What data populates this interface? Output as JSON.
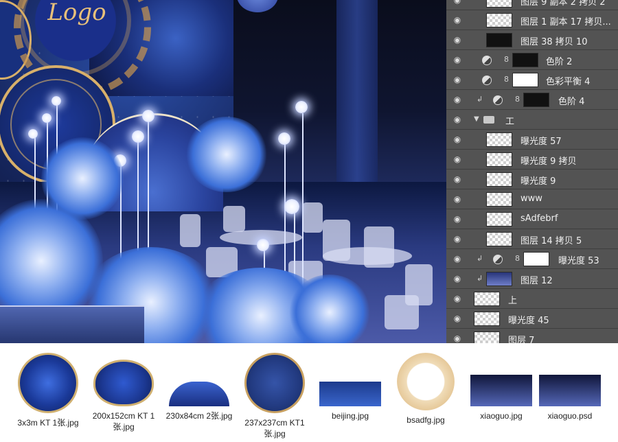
{
  "canvas": {
    "logo_text": "Logo"
  },
  "layers": [
    {
      "name": "图层 9 副本 2 拷贝 2",
      "kind": "pixel"
    },
    {
      "name": "图层 1 副本 17 拷贝...",
      "kind": "pixel"
    },
    {
      "name": "图层 38 拷贝 10",
      "kind": "dark"
    },
    {
      "name": "色阶 2",
      "kind": "adjustment"
    },
    {
      "name": "色彩平衡 4",
      "kind": "adjustment"
    },
    {
      "name": "色阶 4",
      "kind": "adjustment-clipped"
    },
    {
      "name": "工",
      "kind": "group"
    },
    {
      "name": "曝光度 57",
      "kind": "pixel"
    },
    {
      "name": "曝光度 9 拷贝",
      "kind": "pixel"
    },
    {
      "name": "曝光度 9",
      "kind": "pixel"
    },
    {
      "name": "www",
      "kind": "pixel"
    },
    {
      "name": "sAdfebrf",
      "kind": "pixel"
    },
    {
      "name": "图层 14 拷贝 5",
      "kind": "pixel"
    },
    {
      "name": "曝光度 53",
      "kind": "adjustment-clipped"
    },
    {
      "name": "图层 12",
      "kind": "pixel-clipped"
    },
    {
      "name": "上",
      "kind": "pixel-top"
    },
    {
      "name": "曝光度 45",
      "kind": "pixel-top"
    },
    {
      "name": "图层 7",
      "kind": "pixel-top"
    }
  ],
  "files": [
    {
      "name": "3x3m KT 1张.jpg"
    },
    {
      "name": "200x152cm KT 1张.jpg"
    },
    {
      "name": "230x84cm 2张.jpg"
    },
    {
      "name": "237x237cm KT1张.jpg"
    },
    {
      "name": "beijing.jpg"
    },
    {
      "name": "bsadfg.jpg"
    },
    {
      "name": "xiaoguo.jpg"
    },
    {
      "name": "xiaoguo.psd"
    }
  ],
  "colors": {
    "panel_bg": "#535353",
    "canvas_deep_blue": "#16265e",
    "gold_accent": "#d8b06a"
  }
}
